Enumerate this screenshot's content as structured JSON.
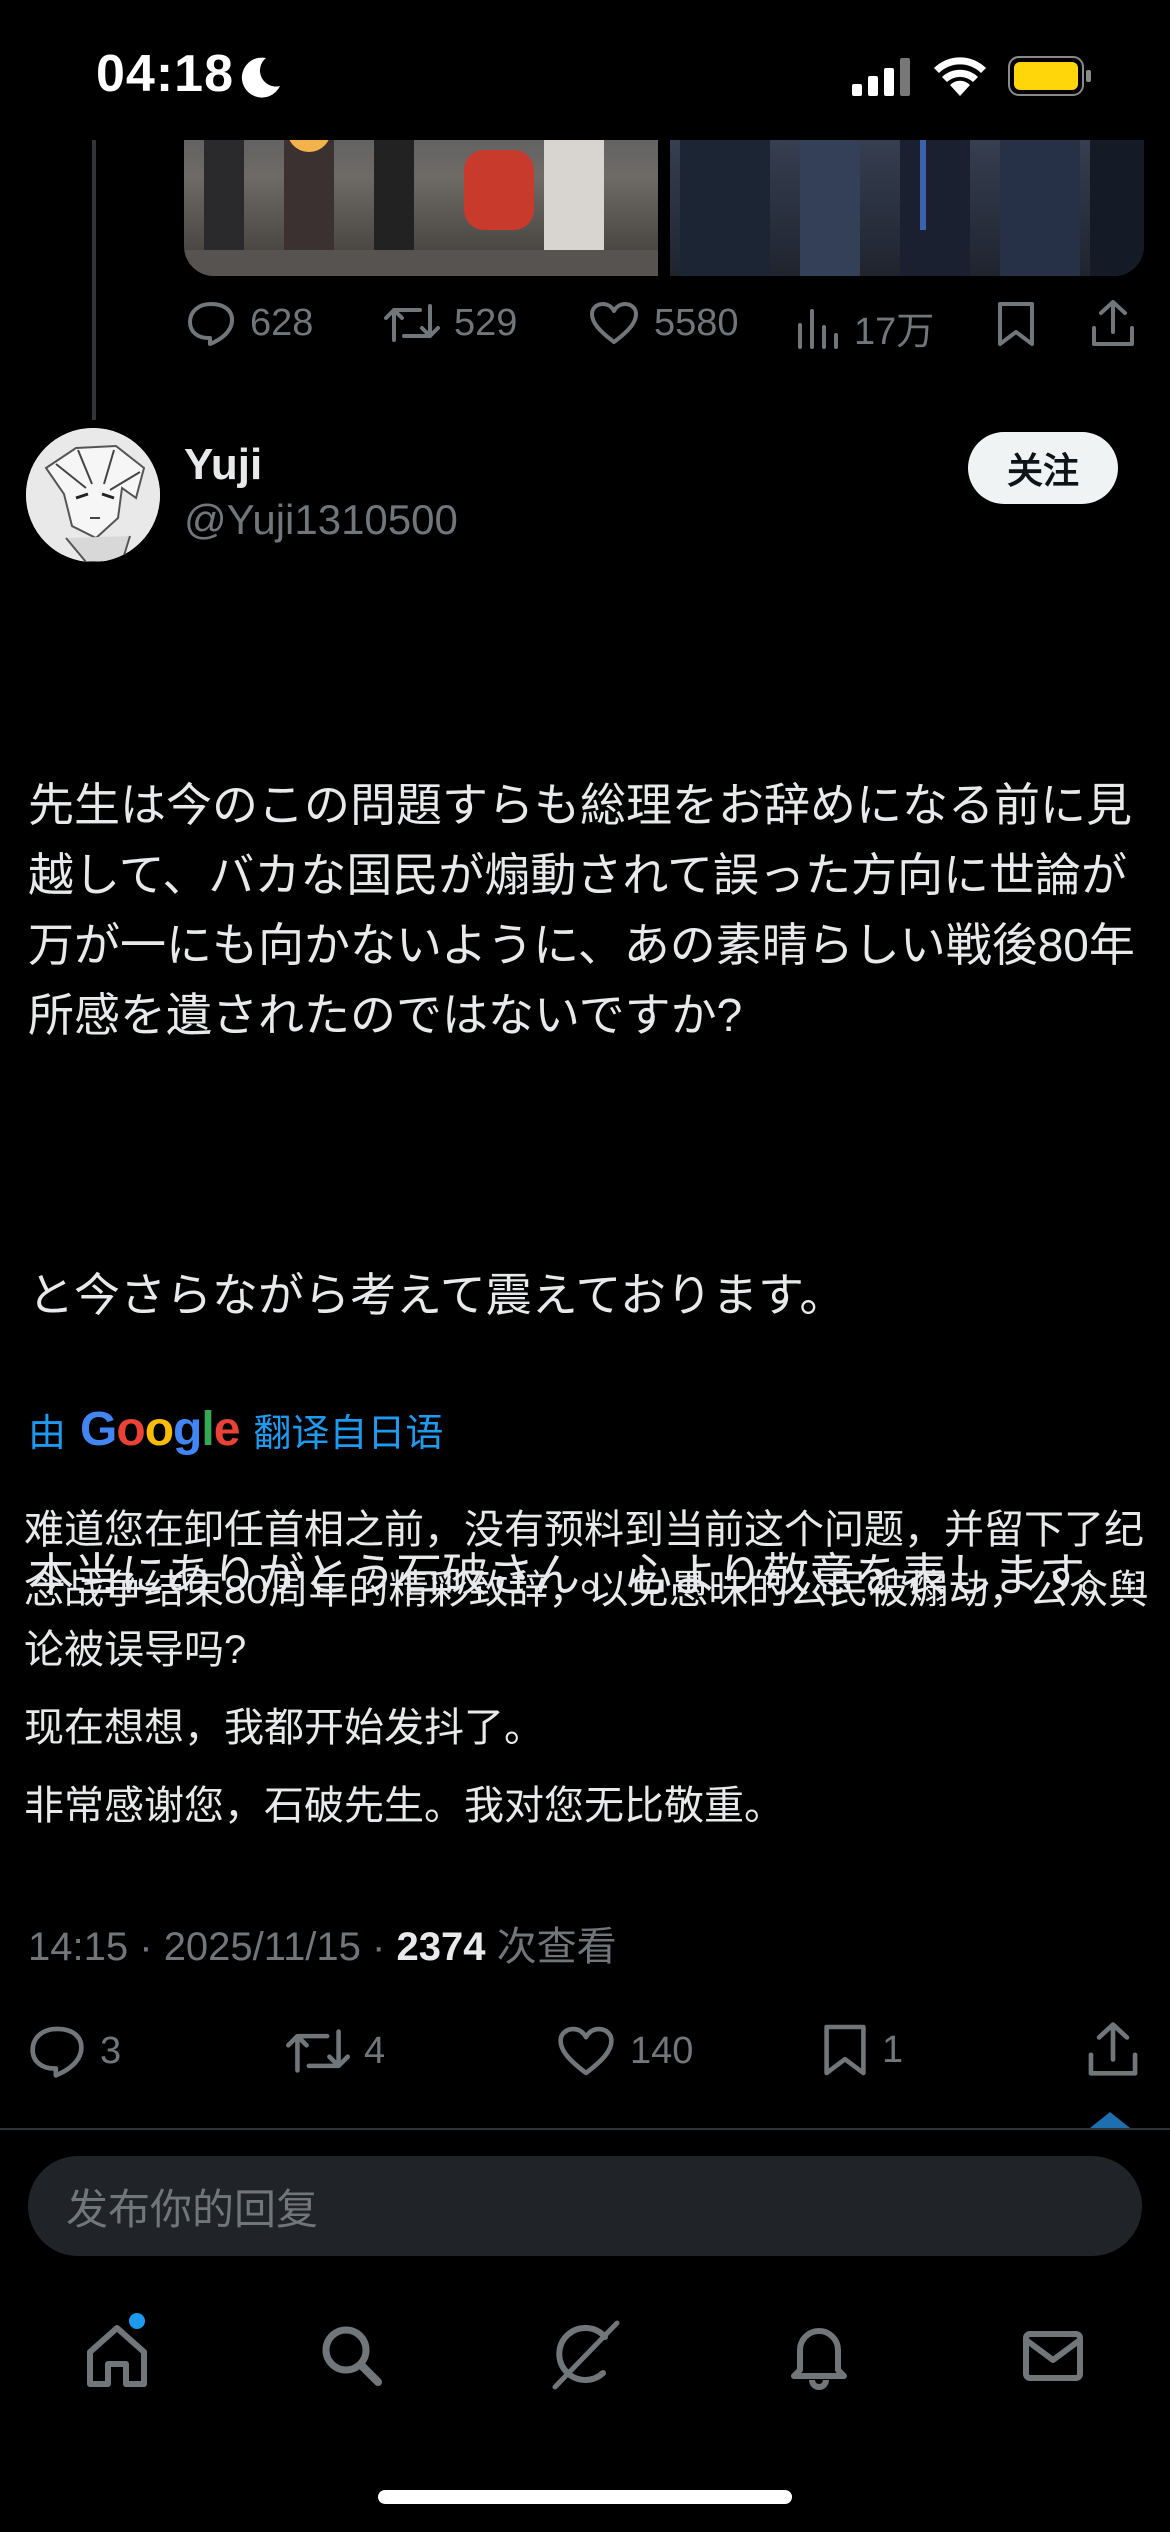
{
  "status_bar": {
    "time": "04:18",
    "battery_color": "#ffd60a"
  },
  "previous_tweet": {
    "actions": {
      "reply_count": "628",
      "retweet_count": "529",
      "like_count": "5580",
      "view_count": "17万"
    }
  },
  "tweet": {
    "author": {
      "display_name": "Yuji",
      "handle": "@Yuji1310500",
      "follow_label": "关注"
    },
    "original_text": {
      "p1": "先生は今のこの問題すらも総理をお辞めになる前に見越して、バカな国民が煽動されて誤った方向に世論が万が一にも向かないように、あの素晴らしい戦後80年所感を遺されたのではないですか?",
      "p2": "と今さらながら考えて震えております。",
      "p3": "本当にありがとう石破さん。心より敬意を表します。"
    },
    "translation": {
      "prefix": "由",
      "google": "Google",
      "suffix": "翻译自日语",
      "p1": "难道您在卸任首相之前，没有预料到当前这个问题，并留下了纪念战争结束80周年的精彩致辞，以免愚昧的公民被煽动，公众舆论被误导吗?",
      "p2": "现在想想，我都开始发抖了。",
      "p3": "非常感谢您，石破先生。我对您无比敬重。"
    },
    "meta": {
      "time": "14:15",
      "sep": "·",
      "date": "2025/11/15",
      "views": "2374",
      "views_label": "次查看"
    },
    "actions": {
      "reply_count": "3",
      "retweet_count": "4",
      "like_count": "140",
      "bookmark_count": "1"
    }
  },
  "reply_input": {
    "placeholder": "发布你的回复"
  },
  "colors": {
    "accent": "#1d9bf0",
    "muted": "#71767b",
    "background": "#000000"
  }
}
